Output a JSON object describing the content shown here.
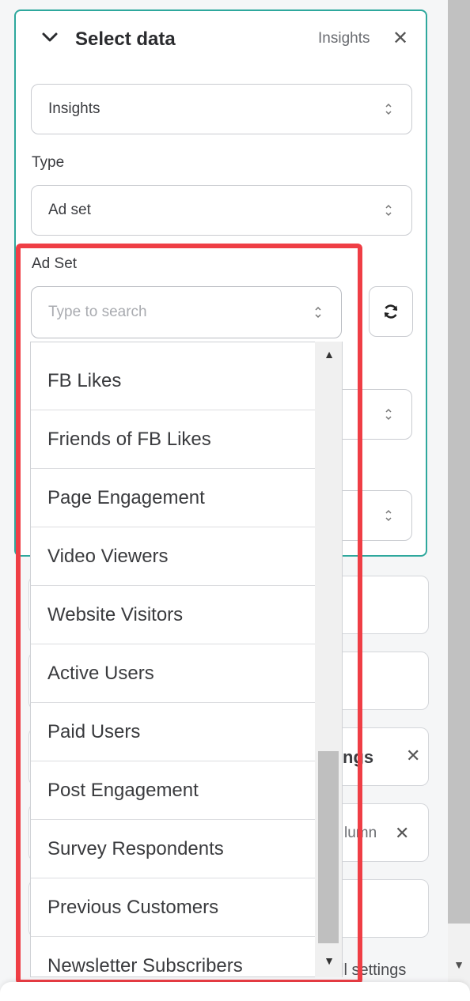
{
  "panel": {
    "title": "Select data",
    "badge": "Insights",
    "close_icon": "close-icon",
    "chevron_icon": "chevron-down-icon"
  },
  "source_select": {
    "value": "Insights"
  },
  "type_field": {
    "label": "Type",
    "value": "Ad set"
  },
  "ad_set_field": {
    "label": "Ad Set",
    "placeholder": "Type to search",
    "reload_icon": "refresh-icon"
  },
  "dropdown": {
    "options": [
      "FB Likes",
      "Friends of FB Likes",
      "Page Engagement",
      "Video Viewers",
      "Website Visitors",
      "Active Users",
      "Paid Users",
      "Post Engagement",
      "Survey Respondents",
      "Previous Customers",
      "Newsletter Subscribers"
    ]
  },
  "background_cards": {
    "settings_fragment": "ngs",
    "column_fragment": "lumn",
    "all_settings_fragment": "ll settings"
  },
  "colors": {
    "accent": "#2ea89d",
    "highlight": "#ef3e45"
  }
}
